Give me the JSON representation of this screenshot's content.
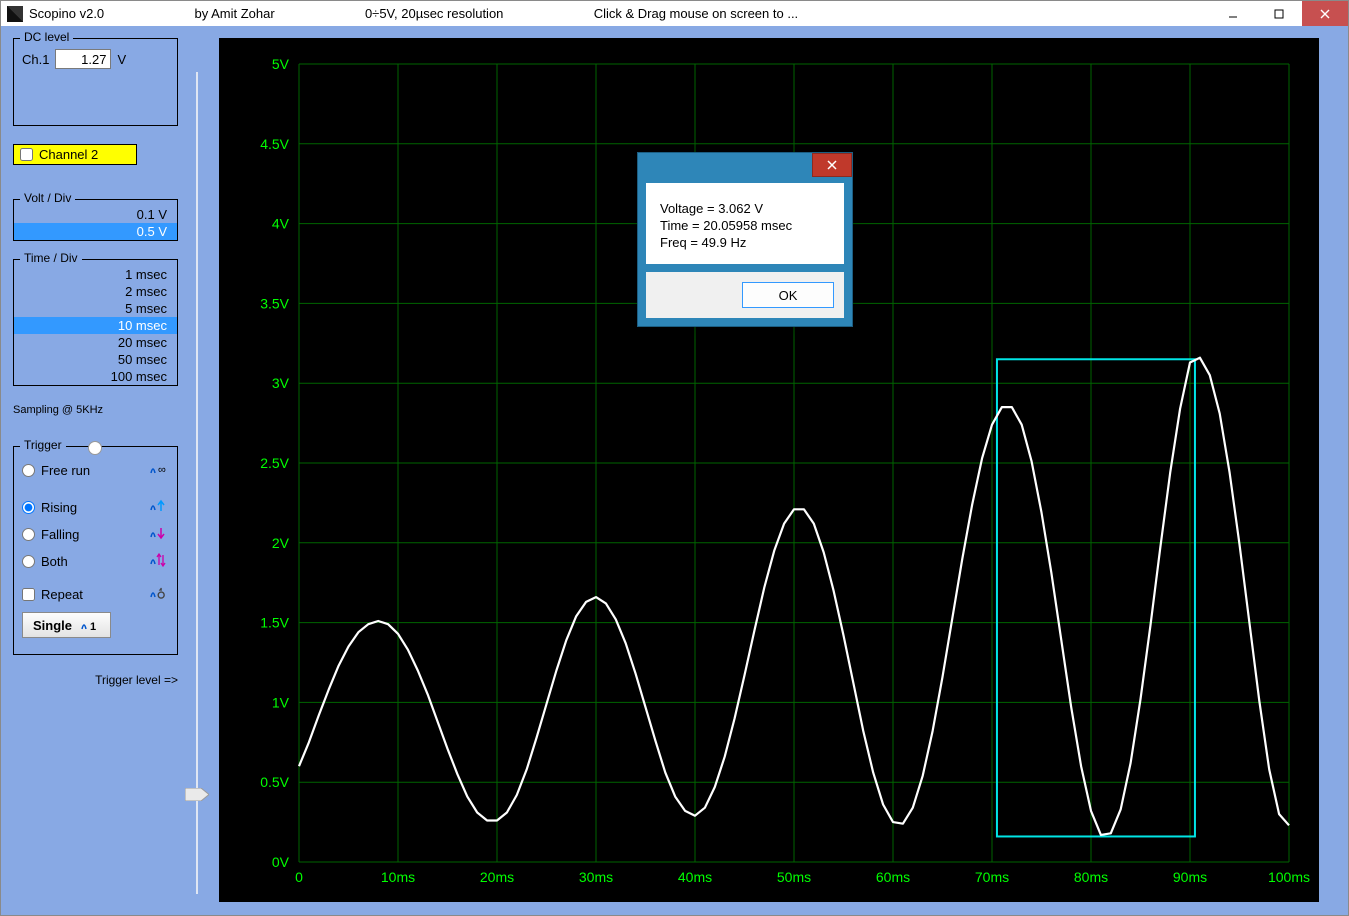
{
  "title": {
    "app": "Scopino v2.0",
    "author": "by Amit Zohar",
    "spec": "0÷5V, 20µsec resolution",
    "hint": "Click & Drag mouse on screen to ..."
  },
  "dc": {
    "legend": "DC level",
    "ch_label": "Ch.1",
    "value": "1.27",
    "unit": "V"
  },
  "channel2": {
    "label": "Channel 2",
    "checked": false
  },
  "voltdiv": {
    "legend": "Volt / Div",
    "options": [
      "0.1 V",
      "0.5 V"
    ],
    "selected_index": 1
  },
  "timediv": {
    "legend": "Time / Div",
    "options": [
      "1 msec",
      "2 msec",
      "5 msec",
      "10 msec",
      "20 msec",
      "50 msec",
      "100 msec"
    ],
    "selected_index": 3,
    "sampling": "Sampling @ 5KHz"
  },
  "trigger": {
    "legend": "Trigger",
    "free": "Free run",
    "rising": "Rising",
    "falling": "Falling",
    "both": "Both",
    "repeat": "Repeat",
    "single": "Single",
    "level_label": "Trigger level =>",
    "mode": "rising",
    "repeat_checked": false
  },
  "modal": {
    "voltage_line": "Voltage = 3.062 V",
    "time_line": "Time = 20.05958 msec",
    "freq_line": "Freq = 49.9 Hz",
    "ok": "OK"
  },
  "chart_data": {
    "type": "line",
    "xlabel": "",
    "ylabel": "",
    "x_unit": "ms",
    "y_unit": "V",
    "xlim": [
      0,
      100
    ],
    "ylim": [
      0,
      5
    ],
    "x_ticks": [
      0,
      10,
      20,
      30,
      40,
      50,
      60,
      70,
      80,
      90,
      100
    ],
    "y_ticks": [
      0,
      0.5,
      1,
      1.5,
      2,
      2.5,
      3,
      3.5,
      4,
      4.5,
      5
    ],
    "y_tick_labels": [
      "0V",
      "0.5V",
      "1V",
      "1.5V",
      "2V",
      "2.5V",
      "3V",
      "3.5V",
      "4V",
      "4.5V",
      "5V"
    ],
    "x_tick_labels": [
      "0",
      "10ms",
      "20ms",
      "30ms",
      "40ms",
      "50ms",
      "60ms",
      "70ms",
      "80ms",
      "90ms",
      "100ms"
    ],
    "selection_box": {
      "x0": 70.5,
      "x1": 90.5,
      "y0": 0.16,
      "y1": 3.15
    },
    "series": [
      {
        "name": "Ch1",
        "color": "#ffffff",
        "points": [
          [
            0,
            0.6
          ],
          [
            1,
            0.75
          ],
          [
            2,
            0.92
          ],
          [
            3,
            1.08
          ],
          [
            4,
            1.23
          ],
          [
            5,
            1.35
          ],
          [
            6,
            1.44
          ],
          [
            7,
            1.49
          ],
          [
            8,
            1.51
          ],
          [
            9,
            1.49
          ],
          [
            10,
            1.43
          ],
          [
            11,
            1.33
          ],
          [
            12,
            1.2
          ],
          [
            13,
            1.05
          ],
          [
            14,
            0.88
          ],
          [
            15,
            0.71
          ],
          [
            16,
            0.55
          ],
          [
            17,
            0.41
          ],
          [
            18,
            0.31
          ],
          [
            19,
            0.26
          ],
          [
            20,
            0.26
          ],
          [
            21,
            0.31
          ],
          [
            22,
            0.42
          ],
          [
            23,
            0.58
          ],
          [
            24,
            0.78
          ],
          [
            25,
            0.99
          ],
          [
            26,
            1.2
          ],
          [
            27,
            1.39
          ],
          [
            28,
            1.54
          ],
          [
            29,
            1.63
          ],
          [
            30,
            1.66
          ],
          [
            31,
            1.62
          ],
          [
            32,
            1.52
          ],
          [
            33,
            1.37
          ],
          [
            34,
            1.18
          ],
          [
            35,
            0.97
          ],
          [
            36,
            0.76
          ],
          [
            37,
            0.56
          ],
          [
            38,
            0.41
          ],
          [
            39,
            0.32
          ],
          [
            40,
            0.29
          ],
          [
            41,
            0.34
          ],
          [
            42,
            0.47
          ],
          [
            43,
            0.66
          ],
          [
            44,
            0.9
          ],
          [
            45,
            1.17
          ],
          [
            46,
            1.45
          ],
          [
            47,
            1.72
          ],
          [
            48,
            1.95
          ],
          [
            49,
            2.12
          ],
          [
            50,
            2.21
          ],
          [
            51,
            2.21
          ],
          [
            52,
            2.12
          ],
          [
            53,
            1.94
          ],
          [
            54,
            1.7
          ],
          [
            55,
            1.42
          ],
          [
            56,
            1.12
          ],
          [
            57,
            0.82
          ],
          [
            58,
            0.56
          ],
          [
            59,
            0.36
          ],
          [
            60,
            0.25
          ],
          [
            61,
            0.24
          ],
          [
            62,
            0.34
          ],
          [
            63,
            0.54
          ],
          [
            64,
            0.82
          ],
          [
            65,
            1.16
          ],
          [
            66,
            1.53
          ],
          [
            67,
            1.9
          ],
          [
            68,
            2.24
          ],
          [
            69,
            2.53
          ],
          [
            70,
            2.74
          ],
          [
            71,
            2.85
          ],
          [
            72,
            2.85
          ],
          [
            73,
            2.74
          ],
          [
            74,
            2.51
          ],
          [
            75,
            2.19
          ],
          [
            76,
            1.81
          ],
          [
            77,
            1.39
          ],
          [
            78,
            0.97
          ],
          [
            79,
            0.6
          ],
          [
            80,
            0.32
          ],
          [
            81,
            0.17
          ],
          [
            82,
            0.18
          ],
          [
            83,
            0.33
          ],
          [
            84,
            0.62
          ],
          [
            85,
            1.02
          ],
          [
            86,
            1.48
          ],
          [
            87,
            1.97
          ],
          [
            88,
            2.44
          ],
          [
            89,
            2.84
          ],
          [
            90,
            3.13
          ],
          [
            91,
            3.16
          ],
          [
            92,
            3.05
          ],
          [
            93,
            2.81
          ],
          [
            94,
            2.44
          ],
          [
            95,
            1.99
          ],
          [
            96,
            1.5
          ],
          [
            97,
            1.01
          ],
          [
            98,
            0.58
          ],
          [
            99,
            0.3
          ],
          [
            100,
            0.23
          ]
        ]
      }
    ]
  },
  "colors": {
    "grid": "#006400",
    "axis_text": "#00ff00",
    "bg": "#000000",
    "sel": "#00e5e5"
  }
}
